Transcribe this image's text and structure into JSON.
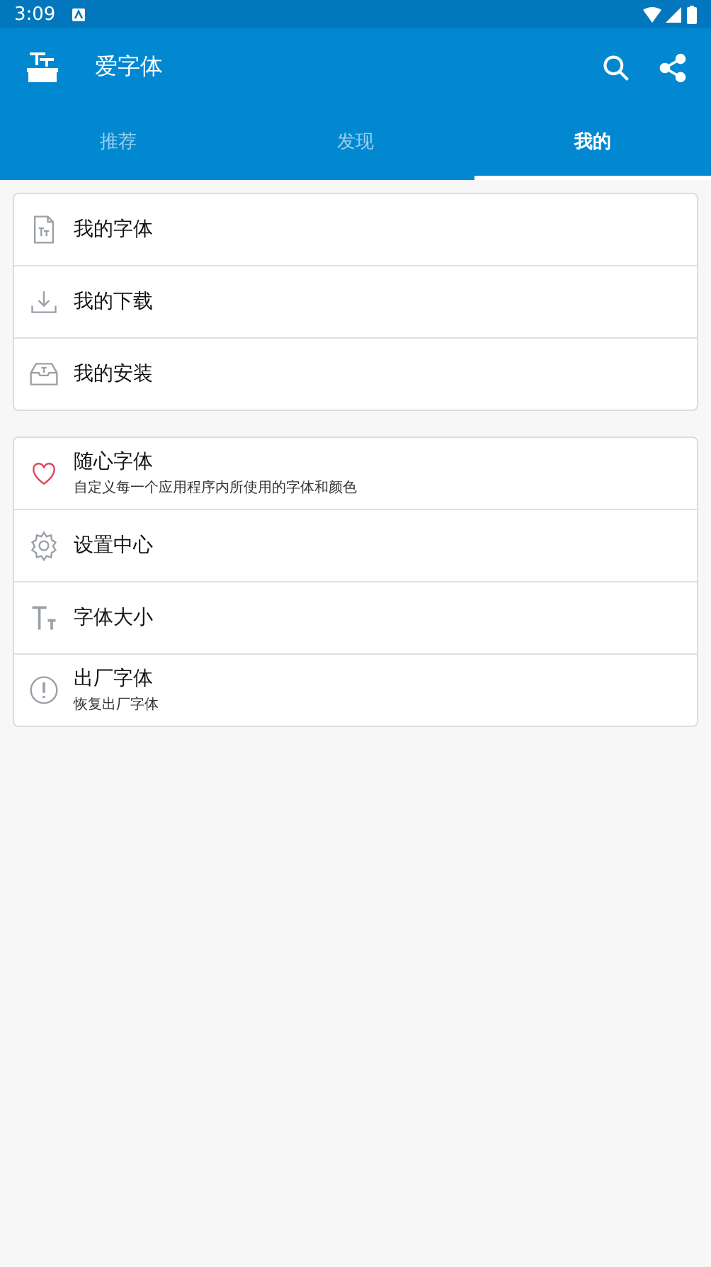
{
  "status_bar": {
    "time": "3:09"
  },
  "app_bar": {
    "title": "爱字体"
  },
  "tabs": [
    {
      "label": "推荐",
      "selected": false
    },
    {
      "label": "发现",
      "selected": false
    },
    {
      "label": "我的",
      "selected": true
    }
  ],
  "groups": [
    {
      "items": [
        {
          "kind": "font-file",
          "title": "我的字体"
        },
        {
          "kind": "download",
          "title": "我的下载"
        },
        {
          "kind": "tray",
          "title": "我的安装"
        }
      ]
    },
    {
      "items": [
        {
          "kind": "heart",
          "title": "随心字体",
          "subtitle": "自定义每一个应用程序内所使用的字体和颜色"
        },
        {
          "kind": "gear",
          "title": "设置中心"
        },
        {
          "kind": "text-size",
          "title": "字体大小"
        },
        {
          "kind": "alert",
          "title": "出厂字体",
          "subtitle": "恢复出厂字体"
        }
      ]
    }
  ]
}
